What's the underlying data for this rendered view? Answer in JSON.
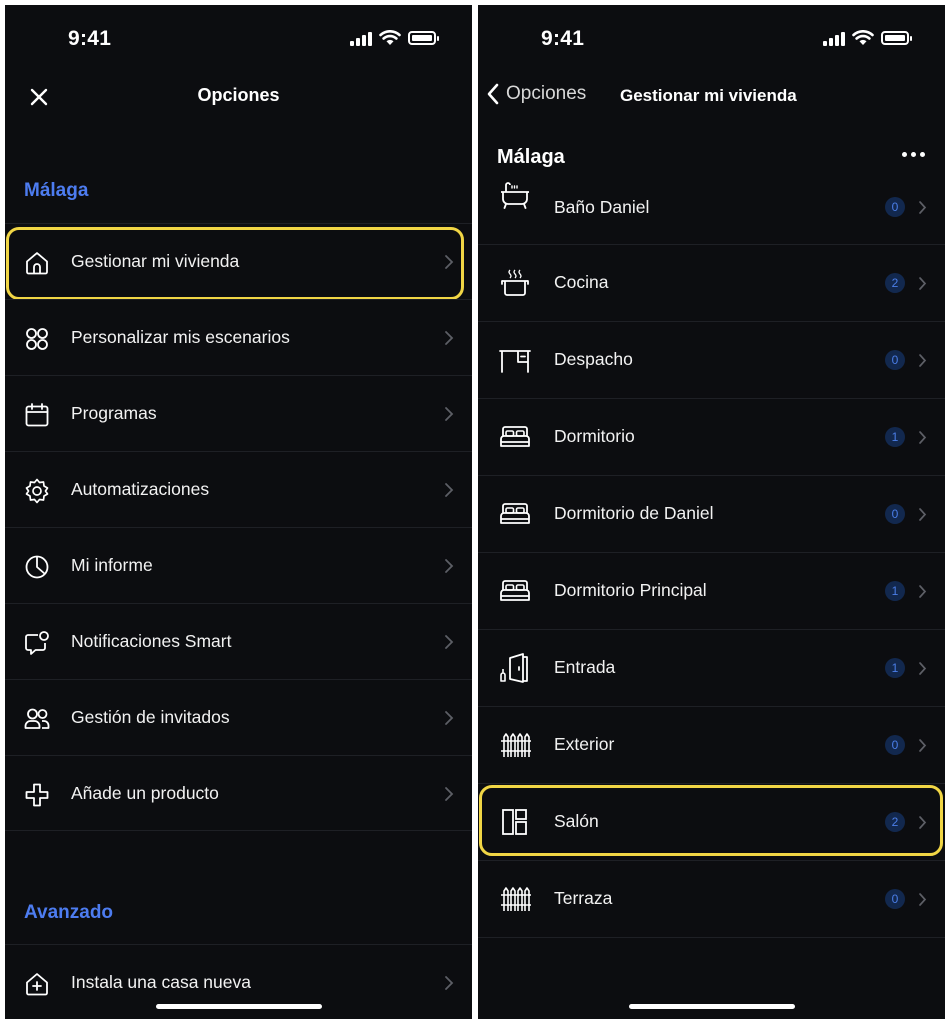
{
  "status_bar": {
    "time": "9:41"
  },
  "left": {
    "title": "Opciones",
    "section_home": "Málaga",
    "menu": [
      {
        "label": "Gestionar mi vivienda",
        "icon": "house-icon",
        "highlighted": true
      },
      {
        "label": "Personalizar mis escenarios",
        "icon": "scenes-icon"
      },
      {
        "label": "Programas",
        "icon": "calendar-icon"
      },
      {
        "label": "Automatizaciones",
        "icon": "gear-icon"
      },
      {
        "label": "Mi informe",
        "icon": "pie-chart-icon"
      },
      {
        "label": "Notificaciones Smart",
        "icon": "chat-bubble-icon"
      },
      {
        "label": "Gestión de invitados",
        "icon": "users-icon"
      },
      {
        "label": "Añade un producto",
        "icon": "plus-icon"
      }
    ],
    "section_advanced": "Avanzado",
    "advanced_menu": [
      {
        "label": "Instala una casa nueva",
        "icon": "house-plus-icon"
      }
    ]
  },
  "right": {
    "back_label": "Opciones",
    "title": "Gestionar mi vivienda",
    "home_name": "Málaga",
    "rooms": [
      {
        "label": "Baño Daniel",
        "count": "0",
        "icon": "bathtub-icon"
      },
      {
        "label": "Cocina",
        "count": "2",
        "icon": "cooking-pot-icon"
      },
      {
        "label": "Despacho",
        "count": "0",
        "icon": "desk-icon"
      },
      {
        "label": "Dormitorio",
        "count": "1",
        "icon": "bed-icon"
      },
      {
        "label": "Dormitorio de Daniel",
        "count": "0",
        "icon": "bed-icon"
      },
      {
        "label": "Dormitorio Principal",
        "count": "1",
        "icon": "bed-icon"
      },
      {
        "label": "Entrada",
        "count": "1",
        "icon": "door-icon"
      },
      {
        "label": "Exterior",
        "count": "0",
        "icon": "fence-icon"
      },
      {
        "label": "Salón",
        "count": "2",
        "icon": "layout-icon",
        "highlighted": true
      },
      {
        "label": "Terraza",
        "count": "0",
        "icon": "fence-icon"
      }
    ]
  },
  "colors": {
    "accent": "#4d7cf0",
    "highlight": "#f1d645",
    "background": "#0c0d10",
    "badge_bg": "#12284e",
    "badge_text": "#4b7ee8"
  }
}
